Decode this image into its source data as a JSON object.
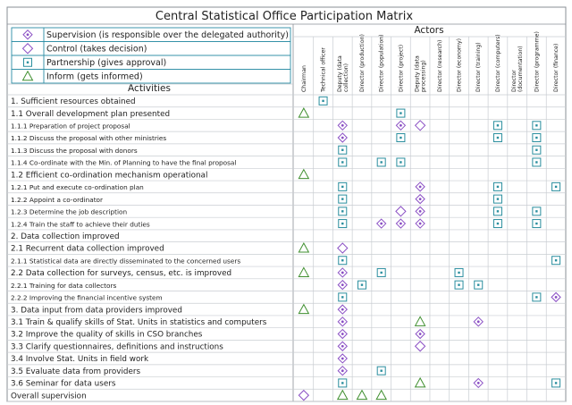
{
  "title": "Central Statistical Office Participation Matrix",
  "actors_header": "Actors",
  "activities_header": "Activities",
  "legend": [
    {
      "symbol": "S",
      "label": "Supervision (is responsible over the delegated authority)"
    },
    {
      "symbol": "C",
      "label": "Control (takes decision)"
    },
    {
      "symbol": "P",
      "label": "Partnership (gives approval)"
    },
    {
      "symbol": "I",
      "label": "Inform (gets informed)"
    }
  ],
  "actors": [
    [
      "Chairman"
    ],
    [
      "Technical officer"
    ],
    [
      "Deputy (data",
      "collection)"
    ],
    [
      "Director (production)"
    ],
    [
      "Director (population)"
    ],
    [
      "Director (project)"
    ],
    [
      "Deputy (data",
      "processing)"
    ],
    [
      "Director (research)"
    ],
    [
      "Director (economy)"
    ],
    [
      "Director (training)"
    ],
    [
      "Director (computers)"
    ],
    [
      "Director",
      "(documentation)"
    ],
    [
      "Director (programme)"
    ],
    [
      "Director (finance)"
    ]
  ],
  "rows": [
    {
      "label": "1. Sufficient resources obtained",
      "level": 0,
      "cells": [
        "",
        "P",
        "",
        "",
        "",
        "",
        "",
        "",
        "",
        "",
        "",
        "",
        "",
        ""
      ]
    },
    {
      "label": "1.1 Overall development plan presented",
      "level": 1,
      "cells": [
        "I",
        "",
        "",
        "",
        "",
        "P",
        "",
        "",
        "",
        "",
        "",
        "",
        "",
        ""
      ]
    },
    {
      "label": "1.1.1 Preparation of project proposal",
      "level": 2,
      "cells": [
        "",
        "",
        "S",
        "",
        "",
        "S",
        "C",
        "",
        "",
        "",
        "P",
        "",
        "P",
        ""
      ]
    },
    {
      "label": "1.1.2 Discuss the proposal with other ministries",
      "level": 2,
      "cells": [
        "",
        "",
        "S",
        "",
        "",
        "P",
        "",
        "",
        "",
        "",
        "P",
        "",
        "P",
        ""
      ]
    },
    {
      "label": "1.1.3 Discuss the proposal with donors",
      "level": 2,
      "cells": [
        "",
        "",
        "P",
        "",
        "",
        "",
        "",
        "",
        "",
        "",
        "",
        "",
        "P",
        ""
      ]
    },
    {
      "label": "1.1.4 Co-ordinate with the Min. of Planning to have the final proposal",
      "level": 2,
      "cells": [
        "",
        "",
        "P",
        "",
        "P",
        "P",
        "",
        "",
        "",
        "",
        "",
        "",
        "P",
        ""
      ]
    },
    {
      "label": "1.2 Efficient co-ordination mechanism operational",
      "level": 1,
      "cells": [
        "I",
        "",
        "",
        "",
        "",
        "",
        "",
        "",
        "",
        "",
        "",
        "",
        "",
        ""
      ]
    },
    {
      "label": "1.2.1 Put and execute co-ordination plan",
      "level": 2,
      "cells": [
        "",
        "",
        "P",
        "",
        "",
        "",
        "S",
        "",
        "",
        "",
        "P",
        "",
        "",
        "P"
      ]
    },
    {
      "label": "1.2.2 Appoint a co-ordinator",
      "level": 2,
      "cells": [
        "",
        "",
        "P",
        "",
        "",
        "",
        "S",
        "",
        "",
        "",
        "P",
        "",
        "",
        ""
      ]
    },
    {
      "label": "1.2.3 Determine the job description",
      "level": 2,
      "cells": [
        "",
        "",
        "P",
        "",
        "",
        "C",
        "S",
        "",
        "",
        "",
        "P",
        "",
        "P",
        ""
      ]
    },
    {
      "label": "1.2.4 Train the staff to achieve their duties",
      "level": 2,
      "cells": [
        "",
        "",
        "P",
        "",
        "S",
        "S",
        "S",
        "",
        "",
        "",
        "P",
        "",
        "P",
        ""
      ]
    },
    {
      "label": "2. Data collection improved",
      "level": 0,
      "cells": [
        "",
        "",
        "",
        "",
        "",
        "",
        "",
        "",
        "",
        "",
        "",
        "",
        "",
        ""
      ]
    },
    {
      "label": "2.1 Recurrent data collection improved",
      "level": 1,
      "cells": [
        "I",
        "",
        "C",
        "",
        "",
        "",
        "",
        "",
        "",
        "",
        "",
        "",
        "",
        ""
      ]
    },
    {
      "label": "2.1.1 Statistical data are directly disseminated to the concerned users",
      "level": 2,
      "cells": [
        "",
        "",
        "P",
        "",
        "",
        "",
        "",
        "",
        "",
        "",
        "",
        "",
        "",
        "P"
      ]
    },
    {
      "label": "2.2 Data collection for surveys, census, etc. is improved",
      "level": 1,
      "cells": [
        "I",
        "",
        "S",
        "",
        "P",
        "",
        "",
        "",
        "P",
        "",
        "",
        "",
        "",
        ""
      ]
    },
    {
      "label": "2.2.1 Training for data collectors",
      "level": 2,
      "cells": [
        "",
        "",
        "S",
        "P",
        "",
        "",
        "",
        "",
        "P",
        "P",
        "",
        "",
        "",
        ""
      ]
    },
    {
      "label": "2.2.2  Improving the financial incentive system",
      "level": 2,
      "cells": [
        "",
        "",
        "P",
        "",
        "",
        "",
        "",
        "",
        "",
        "",
        "",
        "",
        "P",
        "S"
      ]
    },
    {
      "label": "3. Data input from data providers improved",
      "level": 0,
      "cells": [
        "I",
        "",
        "S",
        "",
        "",
        "",
        "",
        "",
        "",
        "",
        "",
        "",
        "",
        ""
      ]
    },
    {
      "label": "3.1 Train & qualify skills of Stat. Units in statistics and computers",
      "level": 1,
      "cells": [
        "",
        "",
        "S",
        "",
        "",
        "",
        "I",
        "",
        "",
        "S",
        "",
        "",
        "",
        ""
      ]
    },
    {
      "label": "3.2 Improve the quality of skills in CSO branches",
      "level": 1,
      "cells": [
        "",
        "",
        "S",
        "",
        "",
        "",
        "S",
        "",
        "",
        "",
        "",
        "",
        "",
        ""
      ]
    },
    {
      "label": "3.3 Clarify questionnaires, definitions and instructions",
      "level": 1,
      "cells": [
        "",
        "",
        "S",
        "",
        "",
        "",
        "C",
        "",
        "",
        "",
        "",
        "",
        "",
        ""
      ]
    },
    {
      "label": "3.4 Involve Stat. Units in field work",
      "level": 1,
      "cells": [
        "",
        "",
        "S",
        "",
        "",
        "",
        "",
        "",
        "",
        "",
        "",
        "",
        "",
        ""
      ]
    },
    {
      "label": "3.5 Evaluate data from providers",
      "level": 1,
      "cells": [
        "",
        "",
        "S",
        "",
        "P",
        "",
        "",
        "",
        "",
        "",
        "",
        "",
        "",
        ""
      ]
    },
    {
      "label": "3.6 Seminar for data users",
      "level": 1,
      "cells": [
        "",
        "",
        "P",
        "",
        "",
        "",
        "I",
        "",
        "",
        "S",
        "",
        "",
        "",
        "P"
      ]
    },
    {
      "label": "Overall supervision",
      "level": 0,
      "cells": [
        "C",
        "",
        "I",
        "I",
        "I",
        "",
        "",
        "",
        "",
        "",
        "",
        "",
        "",
        ""
      ]
    }
  ],
  "colors": {
    "symbol_purple": "#8a4fc4",
    "symbol_teal": "#2a8e9e",
    "symbol_green": "#3f8f2f",
    "grid": "#c9cdd2",
    "border": "#8a8f96",
    "legend_border": "#2a8ca4"
  }
}
